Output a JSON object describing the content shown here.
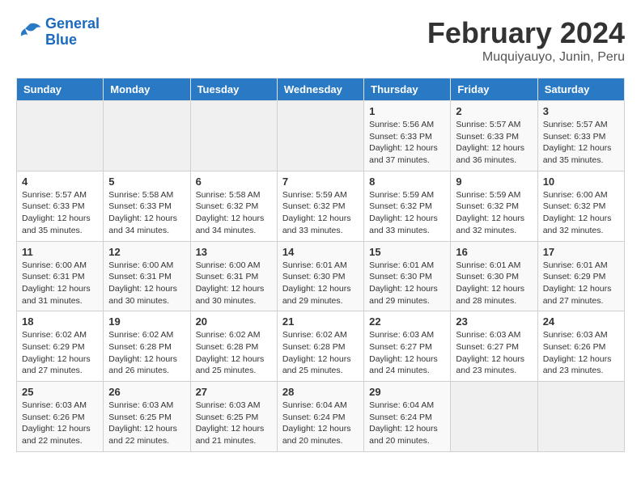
{
  "logo": {
    "line1": "General",
    "line2": "Blue"
  },
  "title": "February 2024",
  "subtitle": "Muquiyauyo, Junin, Peru",
  "days_of_week": [
    "Sunday",
    "Monday",
    "Tuesday",
    "Wednesday",
    "Thursday",
    "Friday",
    "Saturday"
  ],
  "weeks": [
    [
      {
        "day": "",
        "info": ""
      },
      {
        "day": "",
        "info": ""
      },
      {
        "day": "",
        "info": ""
      },
      {
        "day": "",
        "info": ""
      },
      {
        "day": "1",
        "info": "Sunrise: 5:56 AM\nSunset: 6:33 PM\nDaylight: 12 hours\nand 37 minutes."
      },
      {
        "day": "2",
        "info": "Sunrise: 5:57 AM\nSunset: 6:33 PM\nDaylight: 12 hours\nand 36 minutes."
      },
      {
        "day": "3",
        "info": "Sunrise: 5:57 AM\nSunset: 6:33 PM\nDaylight: 12 hours\nand 35 minutes."
      }
    ],
    [
      {
        "day": "4",
        "info": "Sunrise: 5:57 AM\nSunset: 6:33 PM\nDaylight: 12 hours\nand 35 minutes."
      },
      {
        "day": "5",
        "info": "Sunrise: 5:58 AM\nSunset: 6:33 PM\nDaylight: 12 hours\nand 34 minutes."
      },
      {
        "day": "6",
        "info": "Sunrise: 5:58 AM\nSunset: 6:32 PM\nDaylight: 12 hours\nand 34 minutes."
      },
      {
        "day": "7",
        "info": "Sunrise: 5:59 AM\nSunset: 6:32 PM\nDaylight: 12 hours\nand 33 minutes."
      },
      {
        "day": "8",
        "info": "Sunrise: 5:59 AM\nSunset: 6:32 PM\nDaylight: 12 hours\nand 33 minutes."
      },
      {
        "day": "9",
        "info": "Sunrise: 5:59 AM\nSunset: 6:32 PM\nDaylight: 12 hours\nand 32 minutes."
      },
      {
        "day": "10",
        "info": "Sunrise: 6:00 AM\nSunset: 6:32 PM\nDaylight: 12 hours\nand 32 minutes."
      }
    ],
    [
      {
        "day": "11",
        "info": "Sunrise: 6:00 AM\nSunset: 6:31 PM\nDaylight: 12 hours\nand 31 minutes."
      },
      {
        "day": "12",
        "info": "Sunrise: 6:00 AM\nSunset: 6:31 PM\nDaylight: 12 hours\nand 30 minutes."
      },
      {
        "day": "13",
        "info": "Sunrise: 6:00 AM\nSunset: 6:31 PM\nDaylight: 12 hours\nand 30 minutes."
      },
      {
        "day": "14",
        "info": "Sunrise: 6:01 AM\nSunset: 6:30 PM\nDaylight: 12 hours\nand 29 minutes."
      },
      {
        "day": "15",
        "info": "Sunrise: 6:01 AM\nSunset: 6:30 PM\nDaylight: 12 hours\nand 29 minutes."
      },
      {
        "day": "16",
        "info": "Sunrise: 6:01 AM\nSunset: 6:30 PM\nDaylight: 12 hours\nand 28 minutes."
      },
      {
        "day": "17",
        "info": "Sunrise: 6:01 AM\nSunset: 6:29 PM\nDaylight: 12 hours\nand 27 minutes."
      }
    ],
    [
      {
        "day": "18",
        "info": "Sunrise: 6:02 AM\nSunset: 6:29 PM\nDaylight: 12 hours\nand 27 minutes."
      },
      {
        "day": "19",
        "info": "Sunrise: 6:02 AM\nSunset: 6:28 PM\nDaylight: 12 hours\nand 26 minutes."
      },
      {
        "day": "20",
        "info": "Sunrise: 6:02 AM\nSunset: 6:28 PM\nDaylight: 12 hours\nand 25 minutes."
      },
      {
        "day": "21",
        "info": "Sunrise: 6:02 AM\nSunset: 6:28 PM\nDaylight: 12 hours\nand 25 minutes."
      },
      {
        "day": "22",
        "info": "Sunrise: 6:03 AM\nSunset: 6:27 PM\nDaylight: 12 hours\nand 24 minutes."
      },
      {
        "day": "23",
        "info": "Sunrise: 6:03 AM\nSunset: 6:27 PM\nDaylight: 12 hours\nand 23 minutes."
      },
      {
        "day": "24",
        "info": "Sunrise: 6:03 AM\nSunset: 6:26 PM\nDaylight: 12 hours\nand 23 minutes."
      }
    ],
    [
      {
        "day": "25",
        "info": "Sunrise: 6:03 AM\nSunset: 6:26 PM\nDaylight: 12 hours\nand 22 minutes."
      },
      {
        "day": "26",
        "info": "Sunrise: 6:03 AM\nSunset: 6:25 PM\nDaylight: 12 hours\nand 22 minutes."
      },
      {
        "day": "27",
        "info": "Sunrise: 6:03 AM\nSunset: 6:25 PM\nDaylight: 12 hours\nand 21 minutes."
      },
      {
        "day": "28",
        "info": "Sunrise: 6:04 AM\nSunset: 6:24 PM\nDaylight: 12 hours\nand 20 minutes."
      },
      {
        "day": "29",
        "info": "Sunrise: 6:04 AM\nSunset: 6:24 PM\nDaylight: 12 hours\nand 20 minutes."
      },
      {
        "day": "",
        "info": ""
      },
      {
        "day": "",
        "info": ""
      }
    ]
  ]
}
